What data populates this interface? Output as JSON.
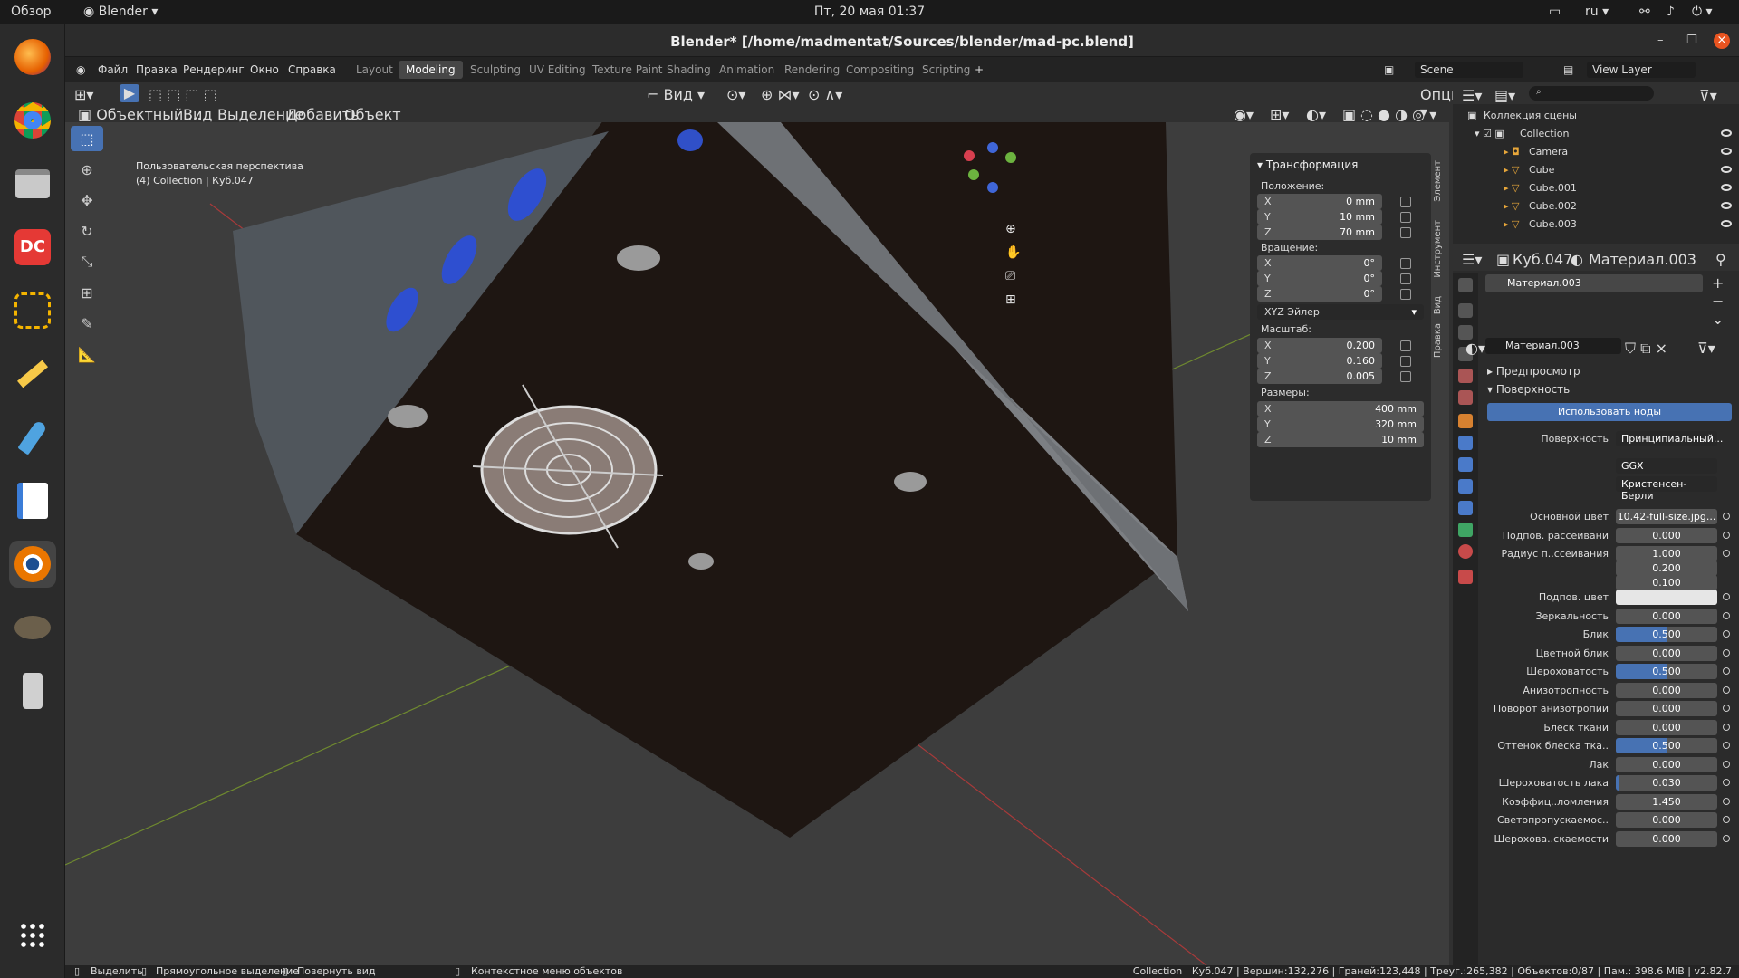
{
  "topbar": {
    "overview": "Обзор",
    "app": "Blender",
    "datetime": "Пт, 20 мая  01:37",
    "lang": "ru"
  },
  "dock": {
    "apps": [
      "firefox-icon",
      "chrome-icon",
      "files-icon",
      "dc-icon",
      "kdenlive-icon",
      "notes-icon",
      "rocket-icon",
      "text-editor-icon",
      "blender-icon",
      "gimp-icon",
      "usb-icon",
      "apps-grid-icon"
    ]
  },
  "window": {
    "title": "Blender* [/home/madmentat/Sources/blender/mad-pc.blend]"
  },
  "menu": {
    "items": [
      "Файл",
      "Правка",
      "Рендеринг",
      "Окно",
      "Справка"
    ],
    "workspaces": [
      "Layout",
      "Modeling",
      "Sculpting",
      "UV Editing",
      "Texture Paint",
      "Shading",
      "Animation",
      "Rendering",
      "Compositing",
      "Scripting"
    ],
    "active": "Modeling",
    "scene": "Scene",
    "view_layer": "View Layer"
  },
  "viewport": {
    "header": [
      "Объектный ...",
      "Вид",
      "Выделение",
      "Добавить",
      "Объект"
    ],
    "view_btn": "Вид",
    "options": "Опции",
    "perspective": "Пользовательская перспектива",
    "collection_info": "(4) Collection | Куб.047"
  },
  "npanel": {
    "title": "Трансформация",
    "location_label": "Положение:",
    "location": [
      {
        "k": "X",
        "v": "0 mm"
      },
      {
        "k": "Y",
        "v": "10 mm"
      },
      {
        "k": "Z",
        "v": "70 mm"
      }
    ],
    "rotation_label": "Вращение:",
    "rotation": [
      {
        "k": "X",
        "v": "0°"
      },
      {
        "k": "Y",
        "v": "0°"
      },
      {
        "k": "Z",
        "v": "0°"
      }
    ],
    "rotation_mode": "XYZ Эйлер",
    "scale_label": "Масштаб:",
    "scale": [
      {
        "k": "X",
        "v": "0.200"
      },
      {
        "k": "Y",
        "v": "0.160"
      },
      {
        "k": "Z",
        "v": "0.005"
      }
    ],
    "dims_label": "Размеры:",
    "dims": [
      {
        "k": "X",
        "v": "400 mm"
      },
      {
        "k": "Y",
        "v": "320 mm"
      },
      {
        "k": "Z",
        "v": "10 mm"
      }
    ],
    "tabs": [
      "Элемент",
      "Инструмент",
      "Вид",
      "Правка"
    ]
  },
  "outliner": {
    "root": "Коллекция сцены",
    "collection": "Collection",
    "items": [
      "Camera",
      "Cube",
      "Cube.001",
      "Cube.002",
      "Cube.003"
    ]
  },
  "properties": {
    "object": "Куб.047",
    "material_tab": "Материал.003",
    "slot": "Материал.003",
    "material": "Материал.003",
    "preview": "Предпросмотр",
    "surface": "Поверхность",
    "use_nodes": "Использовать ноды",
    "surface_label": "Поверхность",
    "surface_value": "Принципиальный...",
    "distribution": "GGX",
    "subsurface_method": "Кристенсен-Берли",
    "rows": [
      {
        "l": "Основной цвет",
        "v": "10.42-full-size.jpg...",
        "s": "n"
      },
      {
        "l": "Подпов. рассеивани",
        "v": "0.000",
        "s": "n"
      },
      {
        "l": "Радиус п..ссеивания",
        "v": "1.000",
        "s": "n"
      },
      {
        "l": "",
        "v": "0.200",
        "s": "n"
      },
      {
        "l": "",
        "v": "0.100",
        "s": "n"
      },
      {
        "l": "Подпов. цвет",
        "v": "",
        "s": "w"
      },
      {
        "l": "Зеркальность",
        "v": "0.000",
        "s": "n"
      },
      {
        "l": "Блик",
        "v": "0.500",
        "s": "b"
      },
      {
        "l": "Цветной блик",
        "v": "0.000",
        "s": "n"
      },
      {
        "l": "Шероховатость",
        "v": "0.500",
        "s": "b"
      },
      {
        "l": "Анизотропность",
        "v": "0.000",
        "s": "n"
      },
      {
        "l": "Поворот анизотропии",
        "v": "0.000",
        "s": "n"
      },
      {
        "l": "Блеск ткани",
        "v": "0.000",
        "s": "n"
      },
      {
        "l": "Оттенок блеска тка..",
        "v": "0.500",
        "s": "b"
      },
      {
        "l": "Лак",
        "v": "0.000",
        "s": "n"
      },
      {
        "l": "Шероховатость лака",
        "v": "0.030",
        "s": "t"
      },
      {
        "l": "Коэффиц..ломления",
        "v": "1.450",
        "s": "n"
      },
      {
        "l": "Светопропускаемос..",
        "v": "0.000",
        "s": "n"
      },
      {
        "l": "Шерохова..скаемости",
        "v": "0.000",
        "s": "n"
      }
    ]
  },
  "status": {
    "select": "Выделить",
    "box": "Прямоугольное выделение",
    "rotate": "Повернуть вид",
    "context": "Контекстное меню объектов",
    "stats": "Collection | Куб.047 | Вершин:132,276 | Граней:123,448 | Треуг.:265,382 | Объектов:0/87 | Пам.: 398.6 MiB | v2.82.7"
  }
}
